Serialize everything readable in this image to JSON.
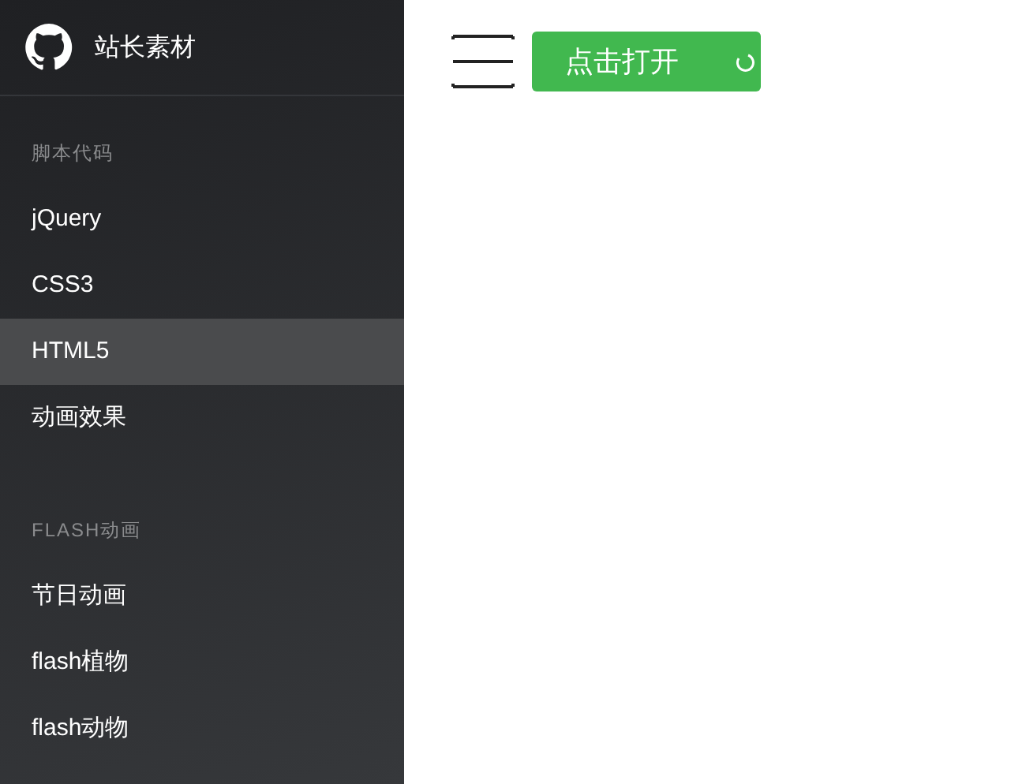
{
  "sidebar": {
    "brand": "站长素材",
    "sections": [
      {
        "heading": "脚本代码",
        "items": [
          {
            "label": "jQuery",
            "selected": false
          },
          {
            "label": "CSS3",
            "selected": false
          },
          {
            "label": "HTML5",
            "selected": true
          },
          {
            "label": "动画效果",
            "selected": false
          }
        ]
      },
      {
        "heading": "FLASH动画",
        "items": [
          {
            "label": "节日动画",
            "selected": false
          },
          {
            "label": "flash植物",
            "selected": false
          },
          {
            "label": "flash动物",
            "selected": false
          }
        ]
      }
    ]
  },
  "open_button": {
    "label": "点击打开"
  }
}
